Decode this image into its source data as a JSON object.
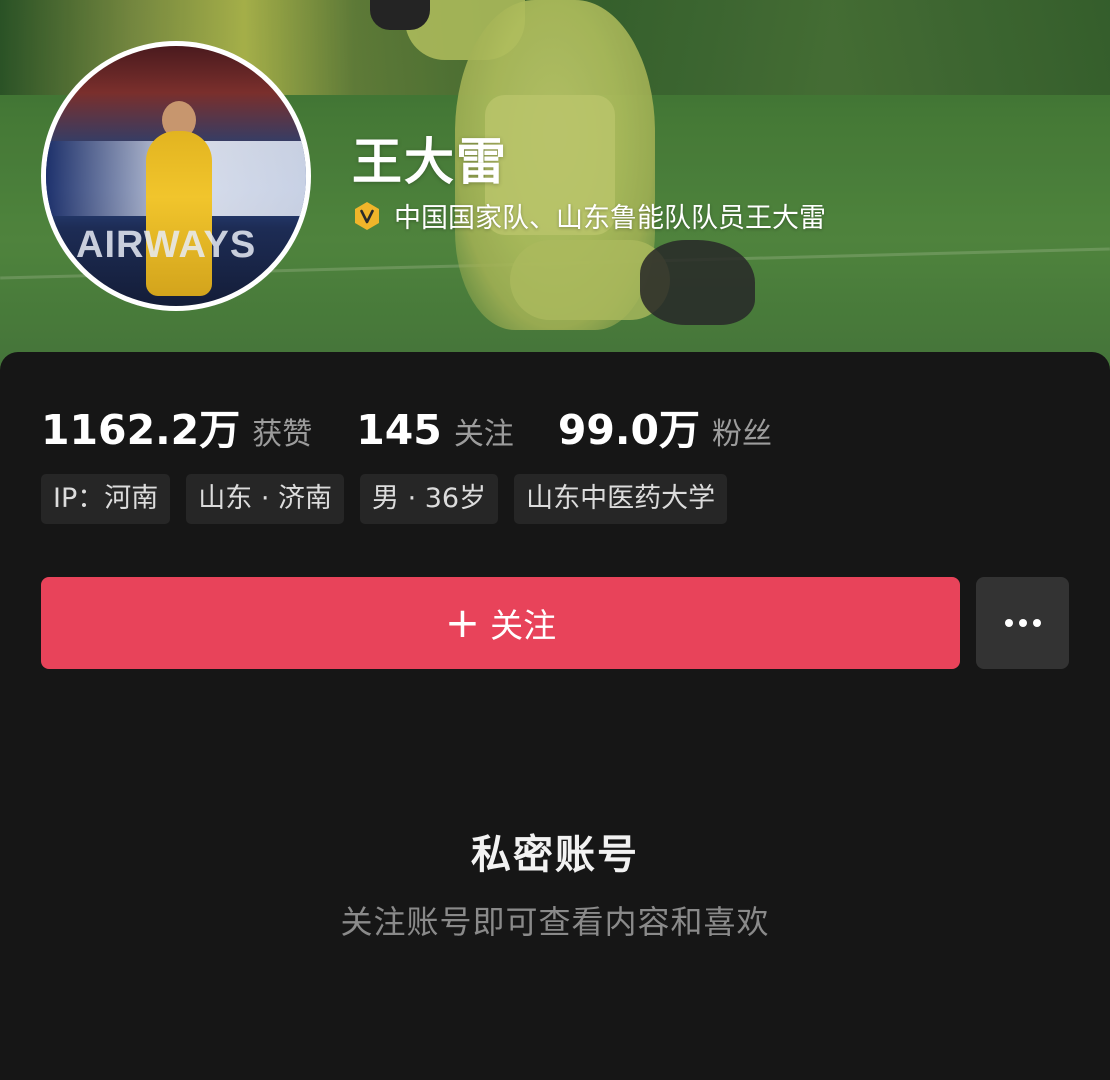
{
  "profile": {
    "name": "王大雷",
    "verification": "中国国家队、山东鲁能队队员王大雷",
    "avatar_text": "AIRWAYS"
  },
  "stats": [
    {
      "value": "1162.2万",
      "label": "获赞"
    },
    {
      "value": "145",
      "label": "关注"
    },
    {
      "value": "99.0万",
      "label": "粉丝"
    }
  ],
  "tags": [
    "IP：河南",
    "山东 · 济南",
    "男 · 36岁",
    "山东中医药大学"
  ],
  "actions": {
    "follow_plus": "+",
    "follow_label": "关注",
    "more_icon": "more-dots-icon"
  },
  "private_notice": {
    "title": "私密账号",
    "subtitle": "关注账号即可查看内容和喜欢"
  },
  "colors": {
    "follow_button": "#e8435a",
    "verify_badge": "#f0b52a",
    "panel_background": "#161616"
  }
}
